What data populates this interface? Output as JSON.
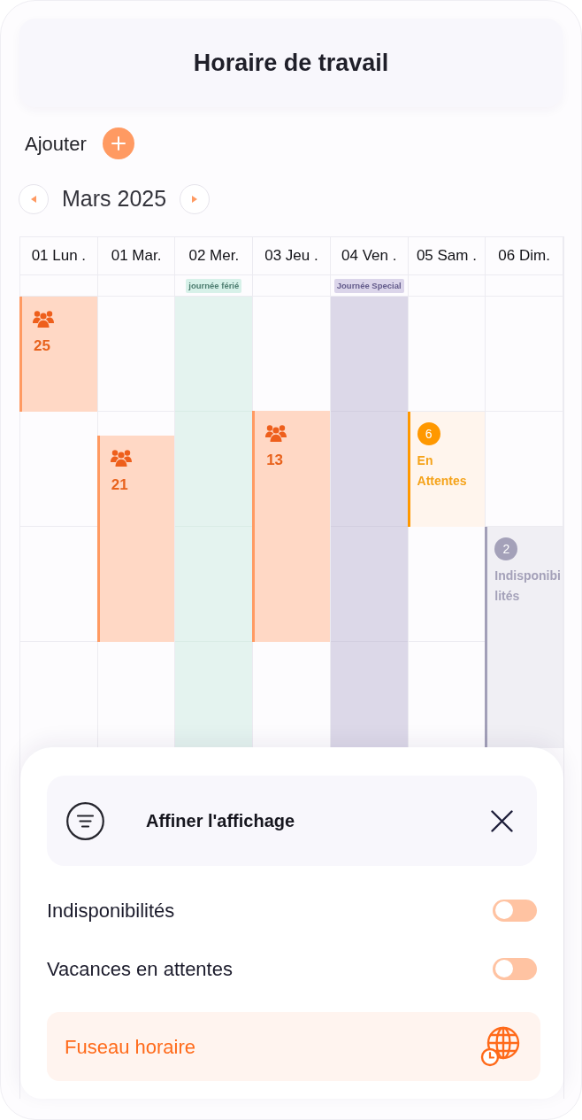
{
  "header": {
    "title": "Horaire de travail"
  },
  "add_action": {
    "label": "Ajouter"
  },
  "month_nav": {
    "label": "Mars 2025"
  },
  "calendar": {
    "days": [
      {
        "label": "01 Lun .",
        "events": [
          {
            "kind": "team",
            "count": "25"
          }
        ]
      },
      {
        "label": "01 Mar.",
        "events": [
          {
            "kind": "team",
            "count": "21"
          }
        ]
      },
      {
        "label": "02 Mer.",
        "tag": {
          "kind": "holiday",
          "text": "journée férié"
        }
      },
      {
        "label": "03 Jeu .",
        "events": [
          {
            "kind": "team",
            "count": "13"
          }
        ]
      },
      {
        "label": "04 Ven .",
        "tag": {
          "kind": "special",
          "text": "Journée Special"
        }
      },
      {
        "label": "05 Sam .",
        "events": [
          {
            "kind": "pending",
            "count": "6",
            "label": "En Attentes"
          }
        ]
      },
      {
        "label": "06 Dim.",
        "events": [
          {
            "kind": "unavailable",
            "count": "2",
            "label": "Indisponibilités"
          }
        ]
      }
    ]
  },
  "filter_sheet": {
    "title": "Affiner l'affichage",
    "options": [
      {
        "label": "Indisponibilités",
        "on": false
      },
      {
        "label": "Vacances en attentes",
        "on": false
      }
    ],
    "timezone_button": {
      "label": "Fuseau horaire"
    }
  }
}
